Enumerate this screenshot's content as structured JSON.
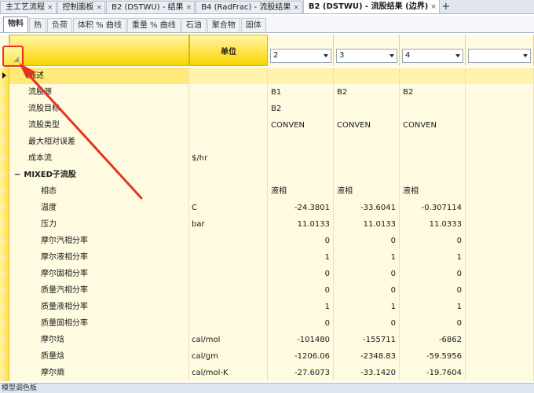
{
  "doc_tabs": [
    {
      "label": "主工艺流程",
      "active": false
    },
    {
      "label": "控制面板",
      "active": false
    },
    {
      "label": "B2 (DSTWU) - 结果",
      "active": false
    },
    {
      "label": "B4 (RadFrac) - 流股结果",
      "active": false
    },
    {
      "label": "B2 (DSTWU) - 流股结果 (边界)",
      "active": true
    }
  ],
  "doc_tab_close": "×",
  "new_tab": "+",
  "sub_tabs": [
    "物料",
    "热",
    "负荷",
    "体积 % 曲线",
    "重量 % 曲线",
    "石油",
    "聚合物",
    "固体"
  ],
  "header": {
    "unit_label": "单位",
    "columns": [
      "2",
      "3",
      "4",
      ""
    ]
  },
  "rows": [
    {
      "label": "描述",
      "indent": 1,
      "unit": "",
      "values": [
        "",
        "",
        "",
        ""
      ],
      "selected": true
    },
    {
      "label": "流股源",
      "indent": 1,
      "unit": "",
      "values": [
        "B1",
        "B2",
        "B2",
        ""
      ]
    },
    {
      "label": "流股目标",
      "indent": 1,
      "unit": "",
      "values": [
        "B2",
        "",
        "",
        ""
      ]
    },
    {
      "label": "流股类型",
      "indent": 1,
      "unit": "",
      "values": [
        "CONVEN",
        "CONVEN",
        "CONVEN",
        ""
      ]
    },
    {
      "label": "最大相对误差",
      "indent": 1,
      "unit": "",
      "values": [
        "",
        "",
        "",
        ""
      ]
    },
    {
      "label": "成本流",
      "indent": 1,
      "unit": "$/hr",
      "values": [
        "",
        "",
        "",
        ""
      ]
    },
    {
      "label": "MIXED子流股",
      "indent": 0,
      "bold": true,
      "expander": "−",
      "unit": "",
      "values": [
        "",
        "",
        "",
        ""
      ]
    },
    {
      "label": "相态",
      "indent": 2,
      "unit": "",
      "values": [
        "液相",
        "液相",
        "液相",
        ""
      ]
    },
    {
      "label": "温度",
      "indent": 2,
      "unit": "C",
      "values": [
        "-24.3801",
        "-33.6041",
        "-0.307114",
        ""
      ],
      "numeric": true
    },
    {
      "label": "压力",
      "indent": 2,
      "unit": "bar",
      "values": [
        "11.0133",
        "11.0133",
        "11.0333",
        ""
      ],
      "numeric": true
    },
    {
      "label": "摩尔汽相分率",
      "indent": 2,
      "unit": "",
      "values": [
        "0",
        "0",
        "0",
        ""
      ],
      "numeric": true
    },
    {
      "label": "摩尔液相分率",
      "indent": 2,
      "unit": "",
      "values": [
        "1",
        "1",
        "1",
        ""
      ],
      "numeric": true
    },
    {
      "label": "摩尔固相分率",
      "indent": 2,
      "unit": "",
      "values": [
        "0",
        "0",
        "0",
        ""
      ],
      "numeric": true
    },
    {
      "label": "质量汽相分率",
      "indent": 2,
      "unit": "",
      "values": [
        "0",
        "0",
        "0",
        ""
      ],
      "numeric": true
    },
    {
      "label": "质量液相分率",
      "indent": 2,
      "unit": "",
      "values": [
        "1",
        "1",
        "1",
        ""
      ],
      "numeric": true
    },
    {
      "label": "质量固相分率",
      "indent": 2,
      "unit": "",
      "values": [
        "0",
        "0",
        "0",
        ""
      ],
      "numeric": true
    },
    {
      "label": "摩尔焓",
      "indent": 2,
      "unit": "cal/mol",
      "values": [
        "-101480",
        "-155711",
        "-6862",
        ""
      ],
      "numeric": true
    },
    {
      "label": "质量焓",
      "indent": 2,
      "unit": "cal/gm",
      "values": [
        "-1206.06",
        "-2348.83",
        "-59.5956",
        ""
      ],
      "numeric": true
    },
    {
      "label": "摩尔熵",
      "indent": 2,
      "unit": "cal/mol-K",
      "values": [
        "-27.6073",
        "-33.1420",
        "-19.7604",
        ""
      ],
      "numeric": true
    }
  ],
  "status_bar": "模型调色板",
  "annotation_color": "#e53323"
}
